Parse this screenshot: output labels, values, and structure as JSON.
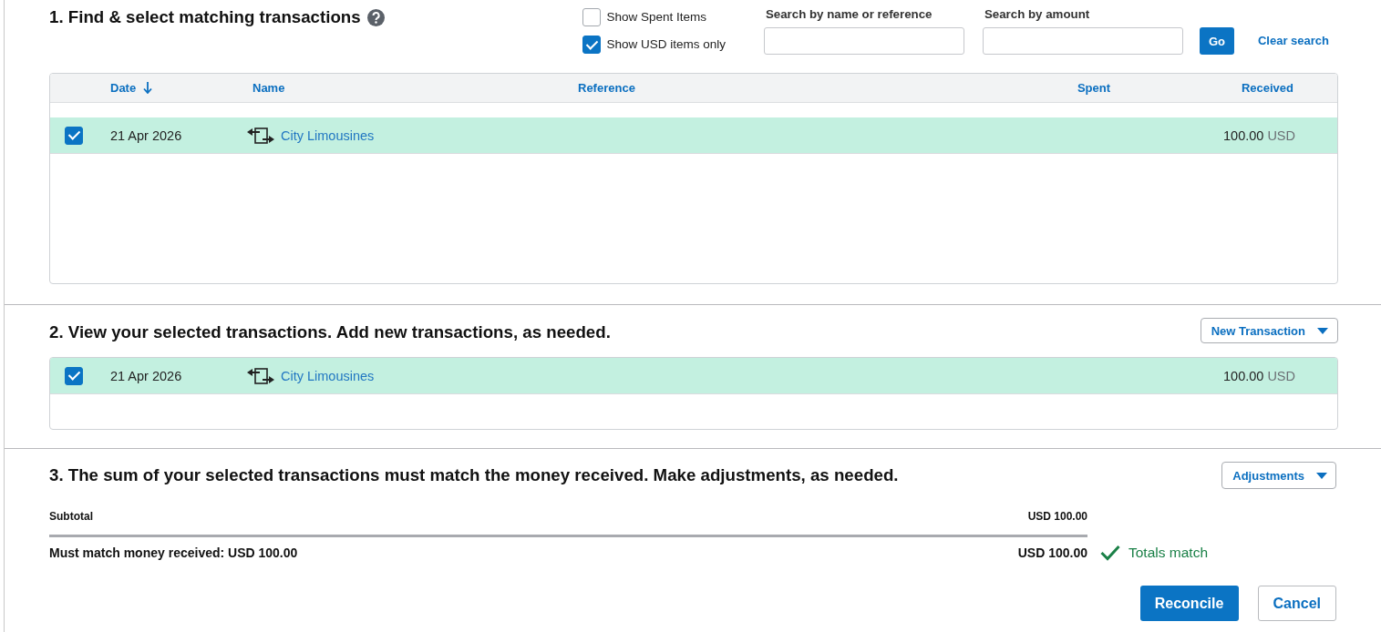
{
  "section_1": {
    "title": "1. Find & select matching transactions",
    "filters": [
      {
        "label": "Show Spent Items",
        "checked": false
      },
      {
        "label": "Show USD items only",
        "checked": true
      }
    ],
    "search_fields": [
      {
        "label": "Search by name or reference"
      },
      {
        "label": "Search by amount"
      }
    ],
    "go_button": "Go",
    "clear_link": "Clear search",
    "table": {
      "columns": [
        {
          "label": "Date",
          "sorted": true
        },
        {
          "label": "Name",
          "sorted": false
        },
        {
          "label": "Reference",
          "sorted": false
        },
        {
          "label": "Spent",
          "sorted": false
        },
        {
          "label": "Received",
          "sorted": false
        }
      ],
      "rows": [
        {
          "checked": true,
          "date": "21 Apr 2026",
          "name": "City Limousines",
          "received": "100.00",
          "currency": "USD"
        }
      ]
    }
  },
  "section_2": {
    "title": "2. View your selected transactions. Add new transactions, as needed.",
    "new_transaction_button": "New Transaction",
    "rows": [
      {
        "checked": true,
        "date": "21 Apr 2026",
        "name": "City Limousines",
        "amount": "100.00",
        "currency": "USD"
      }
    ]
  },
  "section_3": {
    "title": "3. The sum of your selected transactions must match the money received. Make adjustments, as needed.",
    "adjustments_button": "Adjustments",
    "subtotal": {
      "label": "Subtotal",
      "value": "USD 100.00"
    },
    "must_match": {
      "label": "Must match money received: USD 100.00",
      "value": "USD 100.00"
    },
    "status": {
      "text": "Totals match",
      "matched": true
    },
    "buttons": [
      {
        "label": "Reconcile",
        "kind": "primary"
      },
      {
        "label": "Cancel",
        "kind": "secondary"
      }
    ]
  }
}
